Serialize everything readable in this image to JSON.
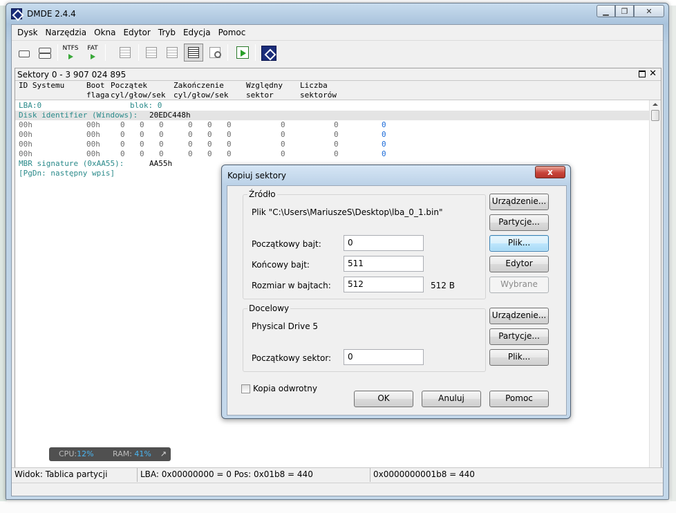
{
  "window": {
    "title": "DMDE 2.4.4"
  },
  "menu": [
    "Dysk",
    "Narzędzia",
    "Okna",
    "Edytor",
    "Tryb",
    "Edycja",
    "Pomoc"
  ],
  "toolbar": {
    "ntfs_label": "NTFS",
    "fat_label": "FAT"
  },
  "panel": {
    "title": "Sektory 0 - 3 907 024 895",
    "columns": {
      "id_system": "ID Systemu",
      "boot": "Boot\nflaga",
      "start": "Początek\ncyl/głow/sek",
      "end": "Zakończenie\ncyl/głow/sek",
      "relative": "Względny\nsektor",
      "count": "Liczba\nsektorów"
    },
    "lba_label": "LBA:0",
    "block_label": "blok: 0",
    "disk_id_label": "Disk identifier (Windows):",
    "disk_id_value": "20EDC448h",
    "rows": [
      {
        "id": "00h",
        "boot": "00h",
        "c1": "0",
        "h1": "0",
        "s1": "0",
        "c2": "0",
        "h2": "0",
        "s2": "0",
        "rel": "0",
        "cnt": "0",
        "extra": "0"
      },
      {
        "id": "00h",
        "boot": "00h",
        "c1": "0",
        "h1": "0",
        "s1": "0",
        "c2": "0",
        "h2": "0",
        "s2": "0",
        "rel": "0",
        "cnt": "0",
        "extra": "0"
      },
      {
        "id": "00h",
        "boot": "00h",
        "c1": "0",
        "h1": "0",
        "s1": "0",
        "c2": "0",
        "h2": "0",
        "s2": "0",
        "rel": "0",
        "cnt": "0",
        "extra": "0"
      },
      {
        "id": "00h",
        "boot": "00h",
        "c1": "0",
        "h1": "0",
        "s1": "0",
        "c2": "0",
        "h2": "0",
        "s2": "0",
        "rel": "0",
        "cnt": "0",
        "extra": "0"
      }
    ],
    "mbr_label": "MBR signature (0xAA55):",
    "mbr_value": "AA55h",
    "pgdn_hint": "[PgDn: następny wpis]"
  },
  "perf": {
    "cpu_label": "CPU:",
    "cpu_value": "12%",
    "ram_label": "RAM:",
    "ram_value": "41%"
  },
  "status": {
    "view": "Widok: Tablica partycji",
    "position": "LBA: 0x00000000 = 0  Pos: 0x01b8 = 440",
    "offset": "0x0000000001b8 = 440"
  },
  "dialog": {
    "title": "Kopiuj sektory",
    "close_label": "x",
    "source": {
      "group_label": "Źródło",
      "file_line": "Plik \"C:\\Users\\MariuszeS\\Desktop\\lba_0_1.bin\"",
      "start_byte_label": "Początkowy bajt:",
      "start_byte_value": "0",
      "end_byte_label": "Końcowy bajt:",
      "end_byte_value": "511",
      "size_label": "Rozmiar w bajtach:",
      "size_value": "512",
      "size_unit": "512 B"
    },
    "source_buttons": {
      "device": "Urządzenie...",
      "partitions": "Partycje...",
      "file": "Plik...",
      "editor": "Edytor",
      "selected": "Wybrane"
    },
    "target": {
      "group_label": "Docelowy",
      "drive_line": "Physical Drive 5",
      "start_sector_label": "Początkowy sektor:",
      "start_sector_value": "0"
    },
    "target_buttons": {
      "device": "Urządzenie...",
      "partitions": "Partycje...",
      "file": "Plik..."
    },
    "reverse_copy_label": "Kopia odwrotny",
    "buttons": {
      "ok": "OK",
      "cancel": "Anuluj",
      "help": "Pomoc"
    }
  }
}
